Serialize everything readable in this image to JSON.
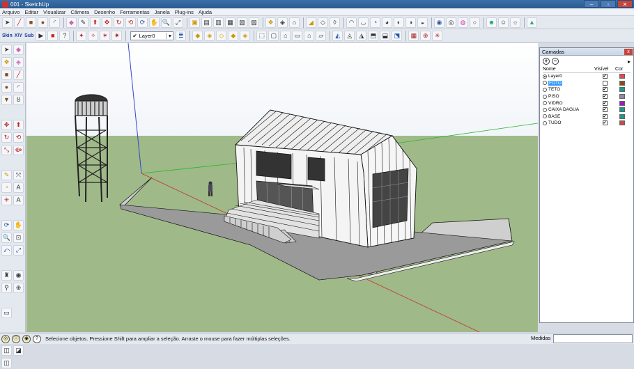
{
  "window": {
    "title": "001 - SketchUp",
    "minimize": "–",
    "maximize": "▫",
    "close": "✕"
  },
  "menu": [
    "Arquivo",
    "Editar",
    "Visualizar",
    "Câmera",
    "Desenho",
    "Ferramentas",
    "Janela",
    "Plug-ins",
    "Ajuda"
  ],
  "toolbar": {
    "skin_label": "Skin",
    "xyz_label": "X\\Y",
    "sub_label": "Sub",
    "current_layer": "Layer0"
  },
  "layers_panel": {
    "title": "Camadas",
    "close": "x",
    "add": "+",
    "remove": "−",
    "details": "▸",
    "columns": {
      "name": "Nome",
      "visible": "Visível",
      "color": "Cor"
    },
    "rows": [
      {
        "name": "Layer0",
        "active": true,
        "visible": true,
        "color": "#e04a4a",
        "selected": false
      },
      {
        "name": "FOTO",
        "active": false,
        "visible": false,
        "color": "#8a4a1a",
        "selected": true
      },
      {
        "name": "TETO",
        "active": false,
        "visible": true,
        "color": "#1a9a8a",
        "selected": false
      },
      {
        "name": "PISO",
        "active": false,
        "visible": true,
        "color": "#8a8a9a",
        "selected": false
      },
      {
        "name": "VIDRO",
        "active": false,
        "visible": true,
        "color": "#9a1ac8",
        "selected": false
      },
      {
        "name": "CAIXA DAGUA",
        "active": false,
        "visible": true,
        "color": "#1a9a8a",
        "selected": false
      },
      {
        "name": "BASE",
        "active": false,
        "visible": true,
        "color": "#1a9a8a",
        "selected": false
      },
      {
        "name": "TUDO",
        "active": false,
        "visible": true,
        "color": "#c84a4a",
        "selected": false
      }
    ]
  },
  "status": {
    "message": "Selecione objetos. Pressione Shift para ampliar a seleção. Arraste o mouse para fazer múltiplas seleções.",
    "measure_label": "Medidas",
    "measure_value": ""
  },
  "colors": {
    "sky": "#ffffff",
    "ground": "#9fb989",
    "accent": "#3399ff"
  }
}
